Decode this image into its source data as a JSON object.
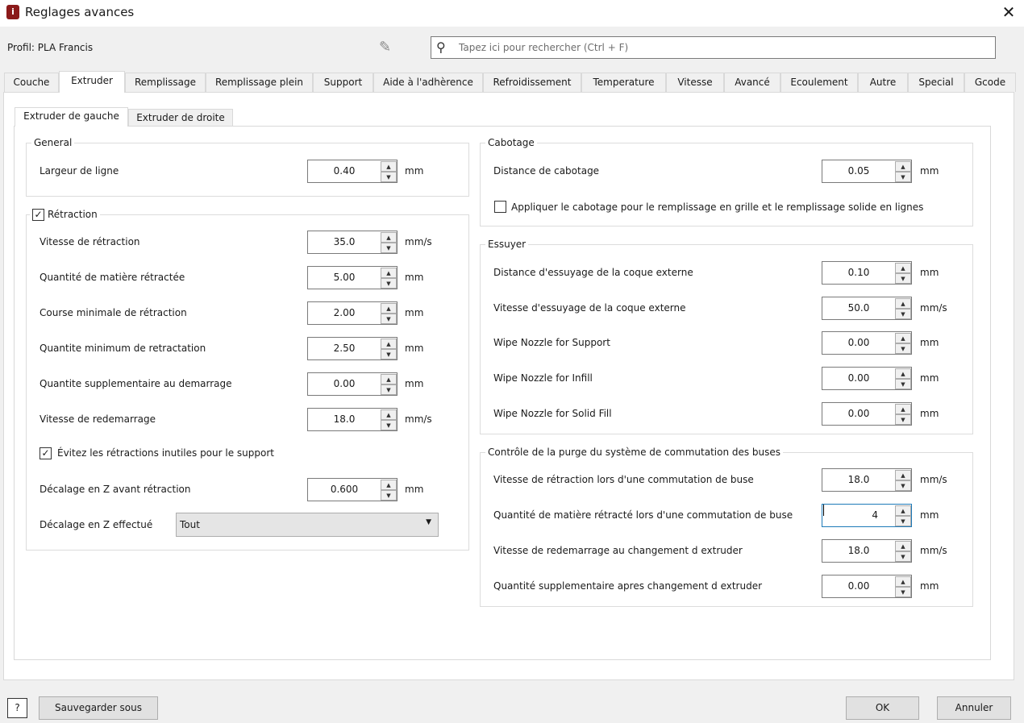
{
  "window": {
    "title": "Reglages avances",
    "close": "✕"
  },
  "profile": "Profil: PLA Francis",
  "search": {
    "placeholder": "Tapez ici pour rechercher (Ctrl + F)"
  },
  "tabs": [
    "Couche",
    "Extruder",
    "Remplissage",
    "Remplissage plein",
    "Support",
    "Aide à l'adhèrence",
    "Refroidissement",
    "Temperature",
    "Vitesse",
    "Avancé",
    "Ecoulement",
    "Autre",
    "Special",
    "Gcode"
  ],
  "active_tab": "Extruder",
  "subtabs": [
    "Extruder de gauche",
    "Extruder de droite"
  ],
  "groups": {
    "general": {
      "title": "General",
      "fields": [
        {
          "label": "Largeur de ligne",
          "value": "0.40",
          "unit": "mm"
        }
      ]
    },
    "retraction": {
      "title": "Rétraction",
      "checked": true,
      "fields": [
        {
          "label": "Vitesse de rétraction",
          "value": "35.0",
          "unit": "mm/s"
        },
        {
          "label": "Quantité de matière rétractée",
          "value": "5.00",
          "unit": "mm"
        },
        {
          "label": "Course minimale de rétraction",
          "value": "2.00",
          "unit": "mm"
        },
        {
          "label": "Quantite minimum de retractation",
          "value": "2.50",
          "unit": "mm"
        },
        {
          "label": "Quantite supplementaire au demarrage",
          "value": "0.00",
          "unit": "mm"
        },
        {
          "label": "Vitesse de redemarrage",
          "value": "18.0",
          "unit": "mm/s"
        }
      ],
      "avoid_checkbox": {
        "label": "Évitez les rétractions inutiles pour le support",
        "checked": true
      },
      "z_offset": {
        "label": "Décalage en Z avant rétraction",
        "value": "0.600",
        "unit": "mm"
      },
      "z_applied": {
        "label": "Décalage en Z effectué",
        "value": "Tout"
      }
    },
    "cabotage": {
      "title": "Cabotage",
      "fields": [
        {
          "label": "Distance de cabotage",
          "value": "0.05",
          "unit": "mm"
        }
      ],
      "checkbox": {
        "label": "Appliquer le cabotage pour le remplissage en grille et le remplissage solide en lignes",
        "checked": false
      }
    },
    "essuyer": {
      "title": "Essuyer",
      "fields": [
        {
          "label": "Distance d'essuyage de la coque externe",
          "value": "0.10",
          "unit": "mm"
        },
        {
          "label": "Vitesse d'essuyage de la coque externe",
          "value": "50.0",
          "unit": "mm/s"
        },
        {
          "label": "Wipe Nozzle for Support",
          "value": "0.00",
          "unit": "mm"
        },
        {
          "label": "Wipe Nozzle for Infill",
          "value": "0.00",
          "unit": "mm"
        },
        {
          "label": "Wipe Nozzle for Solid Fill",
          "value": "0.00",
          "unit": "mm"
        }
      ]
    },
    "purge": {
      "title": "Contrôle de la purge du système de commutation des buses",
      "fields": [
        {
          "label": "Vitesse de rétraction lors d'une commutation de buse",
          "value": "18.0",
          "unit": "mm/s"
        },
        {
          "label": "Quantité de matière rétracté lors d'une commutation de buse",
          "value": "4",
          "unit": "mm",
          "focused": true
        },
        {
          "label": "Vitesse de redemarrage au changement d extruder",
          "value": "18.0",
          "unit": "mm/s"
        },
        {
          "label": "Quantité supplementaire apres changement d extruder",
          "value": "0.00",
          "unit": "mm"
        }
      ]
    }
  },
  "footer": {
    "help": "?",
    "save_as": "Sauvegarder sous",
    "ok": "OK",
    "cancel": "Annuler"
  }
}
